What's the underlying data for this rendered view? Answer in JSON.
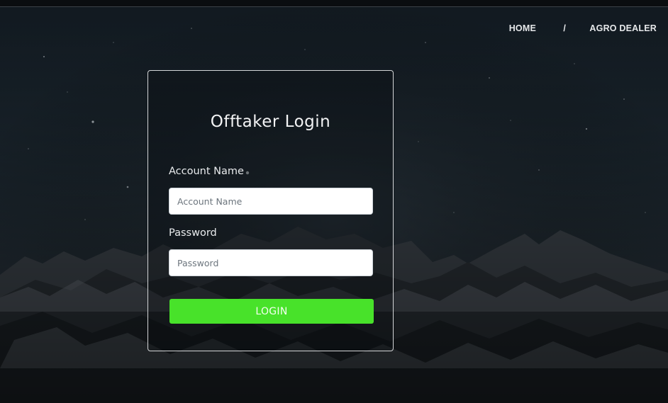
{
  "nav": {
    "home": "HOME",
    "separator": "/",
    "agro_dealer": "AGRO DEALER"
  },
  "login": {
    "title": "Offtaker Login",
    "account_name_label": "Account Name",
    "account_name_placeholder": "Account Name",
    "account_name_value": "",
    "password_label": "Password",
    "password_placeholder": "Password",
    "password_value": "",
    "submit_label": "LOGIN"
  },
  "colors": {
    "login_button": "#48e22a",
    "card_border": "#d4d6d8",
    "nav_text": "#e6e8ea"
  },
  "icons": {
    "background": "night-sky-mountain-image"
  }
}
